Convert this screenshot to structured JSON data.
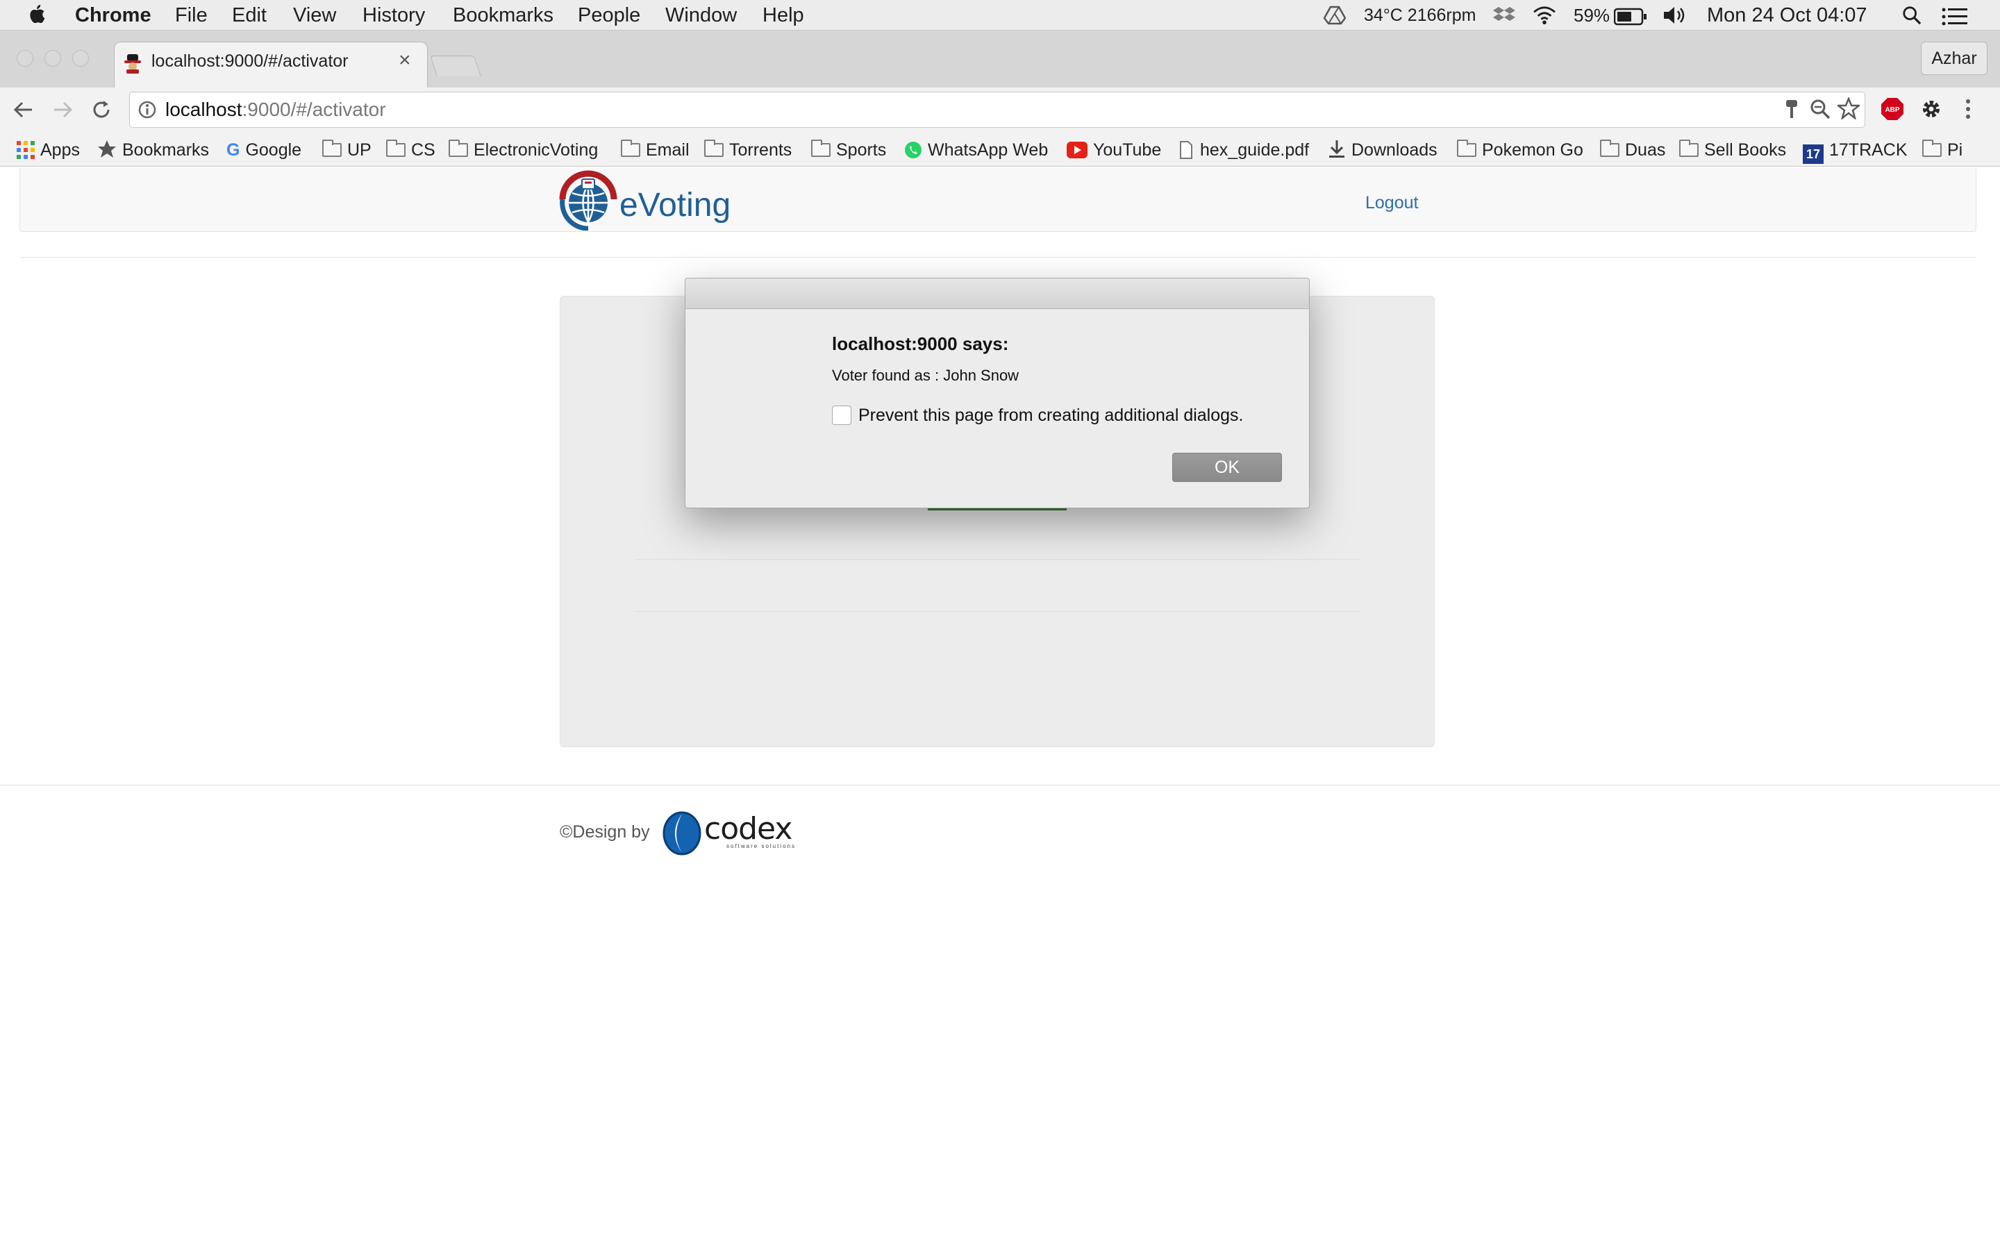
{
  "menubar": {
    "app_name": "Chrome",
    "menus": [
      "File",
      "Edit",
      "View",
      "History",
      "Bookmarks",
      "People",
      "Window",
      "Help"
    ],
    "status": {
      "temp_fan": "34°C 2166rpm",
      "battery": "59%",
      "datetime": "Mon 24 Oct  04:07"
    },
    "icons": [
      "apple-icon",
      "drive-icon",
      "dropbox-icon",
      "wifi-icon",
      "battery-icon",
      "volume-icon",
      "spotlight-icon",
      "notification-center-icon"
    ]
  },
  "browser": {
    "tab": {
      "title": "localhost:9000/#/activator",
      "close": "×"
    },
    "profile_name": "Azhar",
    "url": {
      "host": "localhost",
      "rest": ":9000/#/activator"
    }
  },
  "bookmarks": [
    {
      "label": "Apps",
      "icon": "apps-grid-icon"
    },
    {
      "label": "Bookmarks",
      "icon": "star-icon"
    },
    {
      "label": "Google",
      "icon": "google-icon"
    },
    {
      "label": "UP",
      "icon": "folder-icon"
    },
    {
      "label": "CS",
      "icon": "folder-icon"
    },
    {
      "label": "ElectronicVoting",
      "icon": "folder-icon"
    },
    {
      "label": "Email",
      "icon": "folder-icon"
    },
    {
      "label": "Torrents",
      "icon": "folder-icon"
    },
    {
      "label": "Sports",
      "icon": "folder-icon"
    },
    {
      "label": "WhatsApp Web",
      "icon": "whatsapp-icon"
    },
    {
      "label": "YouTube",
      "icon": "youtube-icon"
    },
    {
      "label": "hex_guide.pdf",
      "icon": "file-icon"
    },
    {
      "label": "Downloads",
      "icon": "download-icon"
    },
    {
      "label": "Pokemon Go",
      "icon": "folder-icon"
    },
    {
      "label": "Duas",
      "icon": "folder-icon"
    },
    {
      "label": "Sell Books",
      "icon": "folder-icon"
    },
    {
      "label": "17TRACK",
      "icon": "17track-icon"
    },
    {
      "label": "Pi",
      "icon": "folder-icon"
    }
  ],
  "page": {
    "brand": "eVoting",
    "logout": "Logout",
    "footer_text": "©Design by",
    "footer_logo": {
      "word": "codex",
      "tagline": "software solutions"
    }
  },
  "dialog": {
    "title": "localhost:9000 says:",
    "message": "Voter found as : John Snow",
    "checkbox_label": "Prevent this page from creating additional dialogs.",
    "ok_label": "OK"
  },
  "colors": {
    "brand_blue": "#1f5f96",
    "brand_red": "#b01f24",
    "link_blue": "#2a6fad",
    "ok_button": "#8f8f8f"
  }
}
